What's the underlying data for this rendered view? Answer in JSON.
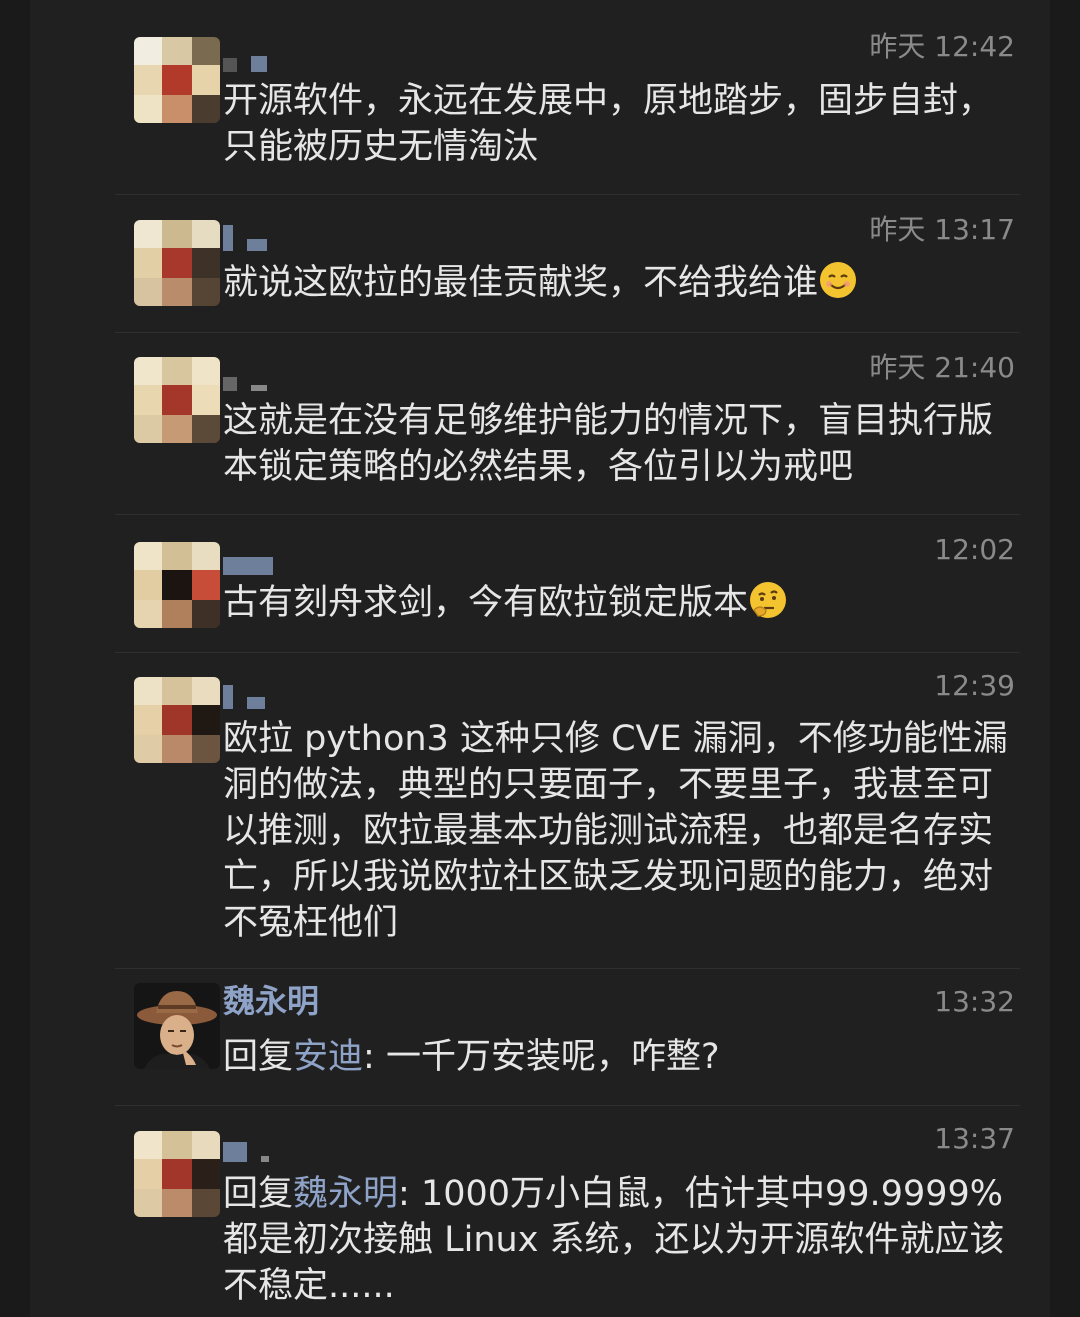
{
  "comments": [
    {
      "time": "昨天 12:42",
      "text": "开源软件，永远在发展中，原地踏步，固步自封，只能被历史无情淘汰",
      "avatar": "pixelated-avatar"
    },
    {
      "time": "昨天 13:17",
      "text": "就说这欧拉的最佳贡献奖，不给我给谁",
      "emoji": "smiling-face-emoji",
      "avatar": "pixelated-avatar"
    },
    {
      "time": "昨天 21:40",
      "text": "这就是在没有足够维护能力的情况下，盲目执行版本锁定策略的必然结果，各位引以为戒吧",
      "avatar": "pixelated-avatar"
    },
    {
      "time": "12:02",
      "text": "古有刻舟求剑，今有欧拉锁定版本",
      "emoji": "thinking-face-emoji",
      "avatar": "pixelated-avatar"
    },
    {
      "time": "12:39",
      "text": "欧拉 python3 这种只修 CVE 漏洞，不修功能性漏洞的做法，典型的只要面子，不要里子，我甚至可以推测，欧拉最基本功能测试流程，也都是名存实亡，所以我说欧拉社区缺乏发现问题的能力，绝对不冤枉他们",
      "avatar": "pixelated-avatar"
    },
    {
      "name": "魏永明",
      "time": "13:32",
      "reply_prefix": "回复",
      "reply_to": "安迪",
      "reply_colon": ":",
      "text": " 一千万安装呢，咋整?",
      "avatar": "cowboy-hat-avatar"
    },
    {
      "time": "13:37",
      "reply_prefix": "回复",
      "reply_to": "魏永明",
      "reply_colon": ": ",
      "text": "1000万小白鼠，估计其中99.9999%都是初次接触 Linux 系统，还以为开源软件就应该不稳定......",
      "avatar": "pixelated-avatar"
    }
  ],
  "colors": {
    "background": "#202020",
    "name": "#8ea3c7",
    "text": "#e6e6e6",
    "time": "#8a8a8a"
  }
}
